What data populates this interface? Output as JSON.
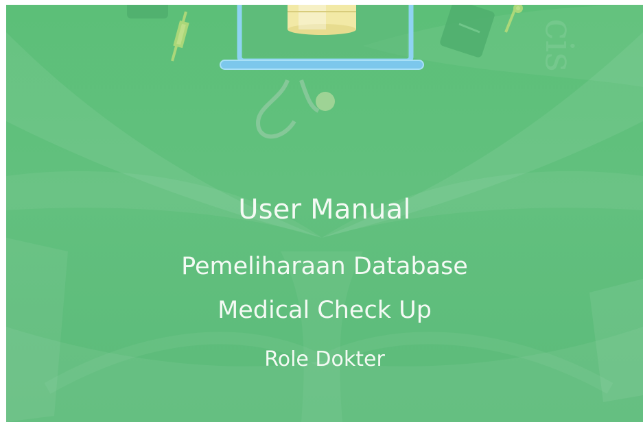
{
  "cover": {
    "title": "User Manual",
    "subtitle_line1": "Pemeliharaan Database",
    "subtitle_line2": "Medical Check Up",
    "role": "Role Dokter",
    "watermark": "cis",
    "colors": {
      "background": "#5cbf78",
      "text": "#f4faf4",
      "laptop_outline": "#8fd3f2",
      "laptop_base": "#6ec3ea",
      "database": "#f2e9a6"
    },
    "icons": [
      "laptop-icon",
      "database-icon",
      "stethoscope-icon",
      "syringe-icon",
      "folder-icon"
    ]
  }
}
